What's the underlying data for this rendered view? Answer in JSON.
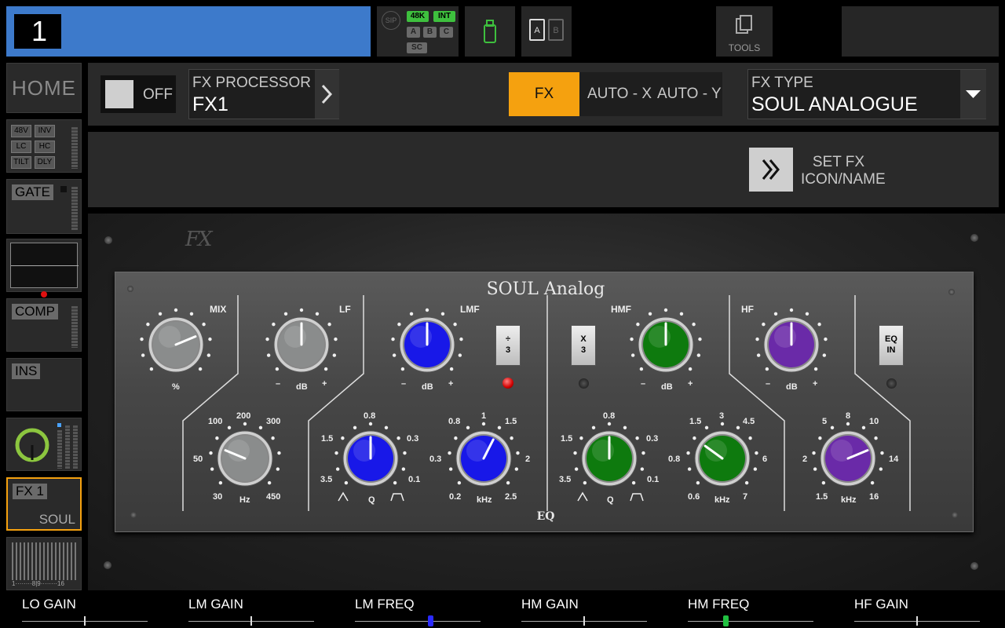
{
  "header": {
    "channel_number": "1",
    "status": {
      "sip": "SIP",
      "rate": "48K",
      "clock": "INT",
      "a": "A",
      "b": "B",
      "c": "C",
      "sc": "SC"
    },
    "card_a": "A",
    "card_b": "B",
    "tools_label": "TOOLS"
  },
  "sidebar": {
    "home": "HOME",
    "input_chips": [
      "48V",
      "INV",
      "LC",
      "HC",
      "TILT",
      "DLY"
    ],
    "gate": "GATE",
    "comp": "COMP",
    "ins": "INS",
    "fx_tile": {
      "name": "FX 1",
      "type": "SOUL"
    },
    "meter_scale": "1········8|9········16"
  },
  "fx_header": {
    "power_state": "OFF",
    "processor_label": "FX PROCESSOR",
    "processor_value": "FX1",
    "tabs": [
      "FX",
      "AUTO - X",
      "AUTO - Y"
    ],
    "active_tab": "FX",
    "type_label": "FX TYPE",
    "type_value": "SOUL ANALOGUE",
    "set_icon_line1": "SET FX",
    "set_icon_line2": "ICON/NAME"
  },
  "device": {
    "logo": "FX",
    "title": "SOUL Analog",
    "eq_label": "EQ",
    "sections": {
      "mix": "MIX",
      "lf": "LF",
      "lmf": "LMF",
      "hmf": "HMF",
      "hf": "HF"
    },
    "units": {
      "pct": "%",
      "db": "dB",
      "hz": "Hz",
      "khz": "kHz",
      "q": "Q",
      "minus": "–",
      "plus": "+"
    },
    "buttons": {
      "div3": "÷\n3",
      "x3": "X\n3",
      "eqin": "EQ\nIN"
    },
    "lf_freq_scale": [
      "100",
      "200",
      "300",
      "50",
      "30",
      "450"
    ],
    "q_scale": [
      "0.8",
      "1.5",
      "0.3",
      "3.5",
      "0.1"
    ],
    "lmf_freq_scale": [
      "0.8",
      "1",
      "1.5",
      "0.3",
      "2",
      "0.2",
      "2.5"
    ],
    "hmf_freq_scale": [
      "1.5",
      "3",
      "4.5",
      "0.8",
      "6",
      "0.6",
      "7"
    ],
    "hf_freq_scale": [
      "5",
      "8",
      "10",
      "2",
      "14",
      "1.5",
      "16"
    ]
  },
  "knobs": {
    "mix": 0.75,
    "lf_gain": 0.5,
    "lmf_gain": 0.5,
    "hmf_gain": 0.5,
    "hf_gain": 0.5,
    "lf_freq": 0.25,
    "lmf_q": 0.5,
    "lmf_freq": 0.6,
    "hmf_q": 0.5,
    "hmf_freq": 0.3,
    "hf_freq": 0.75
  },
  "colors": {
    "accent": "#f5a10f",
    "blue_knob": "#1818e8",
    "green_knob": "#0e7a0e",
    "purple_knob": "#6a2aa8",
    "gray_knob": "#8a8c8c",
    "channel": "#3d7acb"
  },
  "bottom": {
    "labels": [
      "LO GAIN",
      "LM GAIN",
      "LM FREQ",
      "HM GAIN",
      "HM FREQ",
      "HF GAIN"
    ],
    "values": [
      0.5,
      0.5,
      0.6,
      0.5,
      0.3,
      0.5
    ]
  }
}
